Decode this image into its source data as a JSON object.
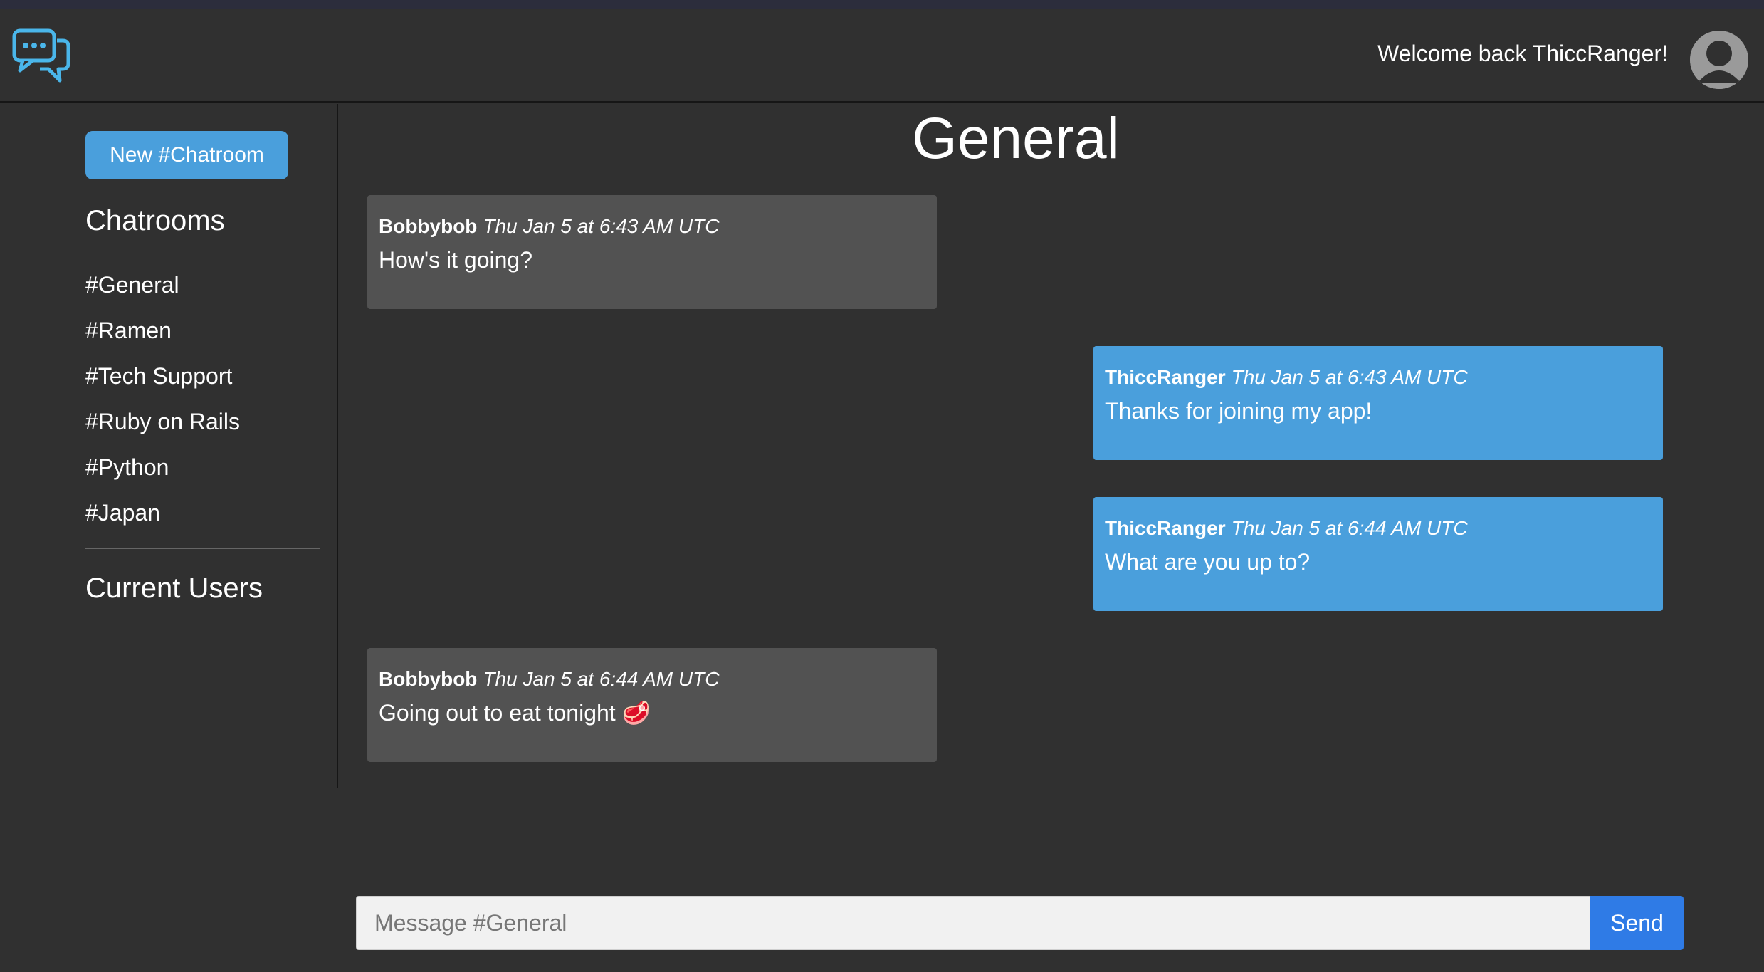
{
  "header": {
    "welcome_text": "Welcome back ThiccRanger!",
    "logo_icon": "chat-bubbles-icon",
    "avatar_icon": "user-avatar-icon"
  },
  "sidebar": {
    "new_chatroom_label": "New #Chatroom",
    "chatrooms_heading": "Chatrooms",
    "rooms": [
      "#General",
      "#Ramen",
      "#Tech Support",
      "#Ruby on Rails",
      "#Python",
      "#Japan"
    ],
    "current_users_heading": "Current Users"
  },
  "chat": {
    "room_title": "General",
    "messages": [
      {
        "user": "Bobbybob",
        "time": "Thu Jan 5 at 6:43 AM UTC",
        "text": "How's it going?",
        "own": false
      },
      {
        "user": "ThiccRanger",
        "time": "Thu Jan 5 at 6:43 AM UTC",
        "text": "Thanks for joining my app!",
        "own": true
      },
      {
        "user": "ThiccRanger",
        "time": "Thu Jan 5 at 6:44 AM UTC",
        "text": "What are you up to?",
        "own": true
      },
      {
        "user": "Bobbybob",
        "time": "Thu Jan 5 at 6:44 AM UTC",
        "text": "Going out to eat tonight 🥩",
        "own": false
      }
    ]
  },
  "composer": {
    "placeholder": "Message #General",
    "send_label": "Send"
  },
  "colors": {
    "background": "#303030",
    "accent": "#4a9fdc",
    "send_button": "#2f7be6",
    "other_message": "#525252"
  }
}
